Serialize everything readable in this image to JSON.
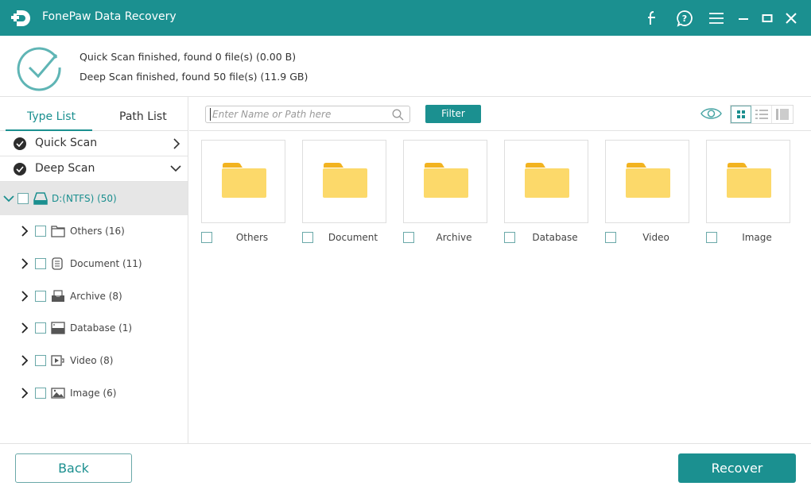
{
  "app": {
    "title": "FonePaw Data Recovery",
    "accent_color": "#1b9090"
  },
  "titlebar_icons": [
    "facebook-icon",
    "help-icon",
    "menu-icon",
    "minimize-icon",
    "maximize-icon",
    "close-icon"
  ],
  "summary": {
    "quick_scan": "Quick Scan finished, found 0 file(s) (0.00  B)",
    "deep_scan": "Deep Scan finished, found 50 file(s) (11.9 GB)"
  },
  "sidebar": {
    "tabs": [
      {
        "label": "Type List",
        "active": true
      },
      {
        "label": "Path List",
        "active": false
      }
    ],
    "scans": [
      {
        "label": "Quick Scan",
        "expanded": false
      },
      {
        "label": "Deep Scan",
        "expanded": true
      }
    ],
    "drive": {
      "label": "D:(NTFS) (50)",
      "checked": false,
      "expanded": true
    },
    "categories": [
      {
        "label": "Others (16)",
        "icon": "folder-icon"
      },
      {
        "label": "Document (11)",
        "icon": "document-icon"
      },
      {
        "label": "Archive (8)",
        "icon": "archive-icon"
      },
      {
        "label": "Database (1)",
        "icon": "database-icon"
      },
      {
        "label": "Video (8)",
        "icon": "video-icon"
      },
      {
        "label": "Image (6)",
        "icon": "image-icon"
      }
    ]
  },
  "toolbar": {
    "search_placeholder": "Enter Name or Path here",
    "search_value": "",
    "filter_label": "Filter",
    "view_mode": "grid"
  },
  "grid": {
    "items": [
      {
        "name": "Others",
        "checked": false
      },
      {
        "name": "Document",
        "checked": false
      },
      {
        "name": "Archive",
        "checked": false
      },
      {
        "name": "Database",
        "checked": false
      },
      {
        "name": "Video",
        "checked": false
      },
      {
        "name": "Image",
        "checked": false
      }
    ]
  },
  "footer": {
    "back_label": "Back",
    "recover_label": "Recover"
  }
}
